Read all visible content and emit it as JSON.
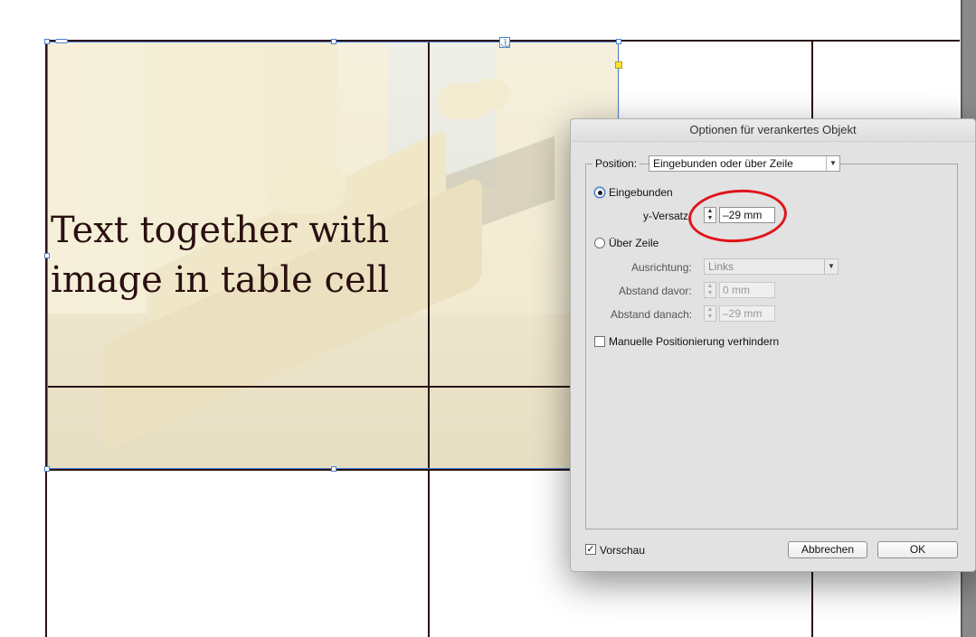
{
  "canvas": {
    "overlay_text": "Text together with\nimage in table cell"
  },
  "dialog": {
    "title": "Optionen für verankertes Objekt",
    "position_label": "Position:",
    "position_value": "Eingebunden oder über Zeile",
    "radio_eingebunden": "Eingebunden",
    "y_versatz_label": "y-Versatz:",
    "y_versatz_value": "–29 mm",
    "radio_ueber_zeile": "Über Zeile",
    "ausrichtung_label": "Ausrichtung:",
    "ausrichtung_value": "Links",
    "abstand_davor_label": "Abstand davor:",
    "abstand_davor_value": "0 mm",
    "abstand_danach_label": "Abstand danach:",
    "abstand_danach_value": "–29 mm",
    "manuelle_label": "Manuelle Positionierung verhindern",
    "vorschau_label": "Vorschau",
    "cancel_label": "Abbrechen",
    "ok_label": "OK"
  },
  "colors": {
    "selection": "#4c7fd6",
    "annotation": "#e0141c",
    "table_rule": "#2a1414"
  },
  "icons": {
    "anchor": "anchor-icon",
    "dropdown": "chevron-down-icon",
    "stepper": "stepper-icon"
  }
}
